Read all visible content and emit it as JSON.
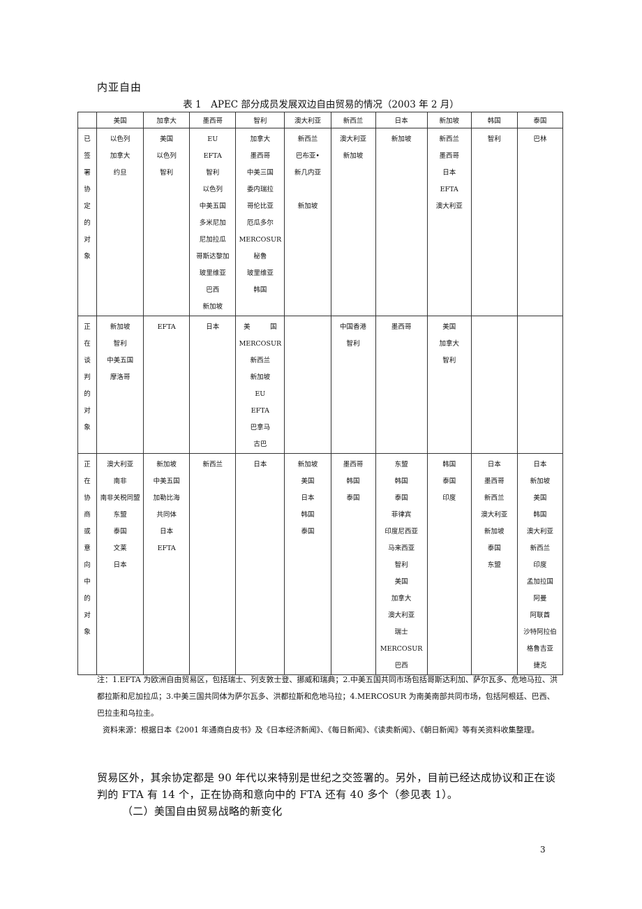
{
  "intro_fragment": "内亚自由",
  "table": {
    "caption": "表 1　APEC 部分成员发展双边自由贸易的情况（2003 年 2 月）",
    "columns": [
      "美国",
      "加拿大",
      "墨西哥",
      "智利",
      "澳大利亚",
      "新西兰",
      "日本",
      "新加坡",
      "韩国",
      "泰国"
    ],
    "rows": [
      {
        "header": [
          "已",
          "签",
          "署",
          "协",
          "定",
          "的",
          "对",
          "象"
        ],
        "cells": [
          [
            "以色列",
            "加拿大",
            "约旦"
          ],
          [
            "美国",
            "以色列",
            "智利"
          ],
          [
            "EU",
            "EFTA",
            "智利",
            "以色列",
            "中美五国",
            "多米尼加",
            "尼加拉瓜",
            "哥斯达黎加",
            "玻里维亚",
            "巴西",
            "新加坡"
          ],
          [
            "加拿大",
            "墨西哥",
            "中美三国",
            "委内瑞拉",
            "哥伦比亚",
            "厄瓜多尔",
            "MERCOSUR",
            "秘鲁",
            "玻里维亚",
            "韩国"
          ],
          [
            "新西兰",
            "巴布亚•",
            "新几内亚",
            "",
            "新加坡"
          ],
          [
            "澳大利亚",
            "新加坡"
          ],
          [
            "新加坡"
          ],
          [
            "新西兰",
            "墨西哥",
            "日本",
            "EFTA",
            "澳大利亚"
          ],
          [
            "智利"
          ],
          [
            "巴林"
          ]
        ]
      },
      {
        "header": [
          "正",
          "在",
          "谈",
          "判",
          "的",
          "对",
          "象"
        ],
        "cells": [
          [
            "新加坡",
            "智利",
            "中美五国",
            "摩洛哥"
          ],
          [
            "EFTA"
          ],
          [
            "日本"
          ],
          [
            "美　　　国",
            "MERCOSUR",
            "新西兰",
            "新加坡",
            "EU",
            "EFTA",
            "巴拿马",
            "古巴"
          ],
          [],
          [
            "中国香港",
            "智利"
          ],
          [
            "墨西哥"
          ],
          [
            "美国",
            "加拿大",
            "智利"
          ],
          [],
          []
        ]
      },
      {
        "header": [
          "正",
          "在",
          "协",
          "商",
          "或",
          "意",
          "向",
          "中",
          "的",
          "对",
          "象"
        ],
        "cells": [
          [
            "澳大利亚",
            "南非",
            "南非关税同盟",
            "东盟",
            "泰国",
            "文莱",
            "日本"
          ],
          [
            "新加坡",
            "中美五国",
            "加勒比海",
            "共同体",
            "日本",
            "EFTA"
          ],
          [
            "新西兰"
          ],
          [
            "日本"
          ],
          [
            "新加坡",
            "美国",
            "日本",
            "韩国",
            "泰国"
          ],
          [
            "墨西哥",
            "韩国",
            "泰国"
          ],
          [
            "东盟",
            "韩国",
            "泰国",
            "菲律宾",
            "印度尼西亚",
            "马来西亚",
            "智利",
            "美国",
            "加拿大",
            "澳大利亚",
            "瑞士",
            "MERCOSUR",
            "巴西"
          ],
          [
            "韩国",
            "泰国",
            "印度"
          ],
          [
            "日本",
            "墨西哥",
            "新西兰",
            "澳大利亚",
            "新加坡",
            "泰国",
            "东盟"
          ],
          [
            "日本",
            "新加坡",
            "美国",
            "韩国",
            "澳大利亚",
            "新西兰",
            "印度",
            "孟加拉国",
            "阿曼",
            "阿联酋",
            "沙特阿拉伯",
            "格鲁吉亚",
            "捷克"
          ]
        ]
      }
    ]
  },
  "notes": {
    "note": "注：1.EFTA 为欧洲自由贸易区，包括瑞士、列支敦士登、挪威和瑞典；2.中美五国共同市场包括哥斯达利加、萨尔瓦多、危地马拉、洪都拉斯和尼加拉瓜；3.中美三国共同体为萨尔瓦多、洪都拉斯和危地马拉；4.MERCOSUR 为南美南部共同市场，包括阿根廷、巴西、巴拉圭和乌拉圭。",
    "source": "资料来源：根据日本《2001 年通商白皮书》及《日本经济新闻》、《每日新闻》、《读卖新闻》、《朝日新闻》等有关资料收集整理。"
  },
  "body": {
    "paragraph": "贸易区外，其余协定都是 90 年代以来特别是世纪之交签署的。另外，目前已经达成协议和正在谈判的 FTA 有 14 个，正在协商和意向中的 FTA 还有 40 多个（参见表 1）。",
    "section_heading": "（二）美国自由贸易战略的新变化"
  },
  "page_number": "3"
}
